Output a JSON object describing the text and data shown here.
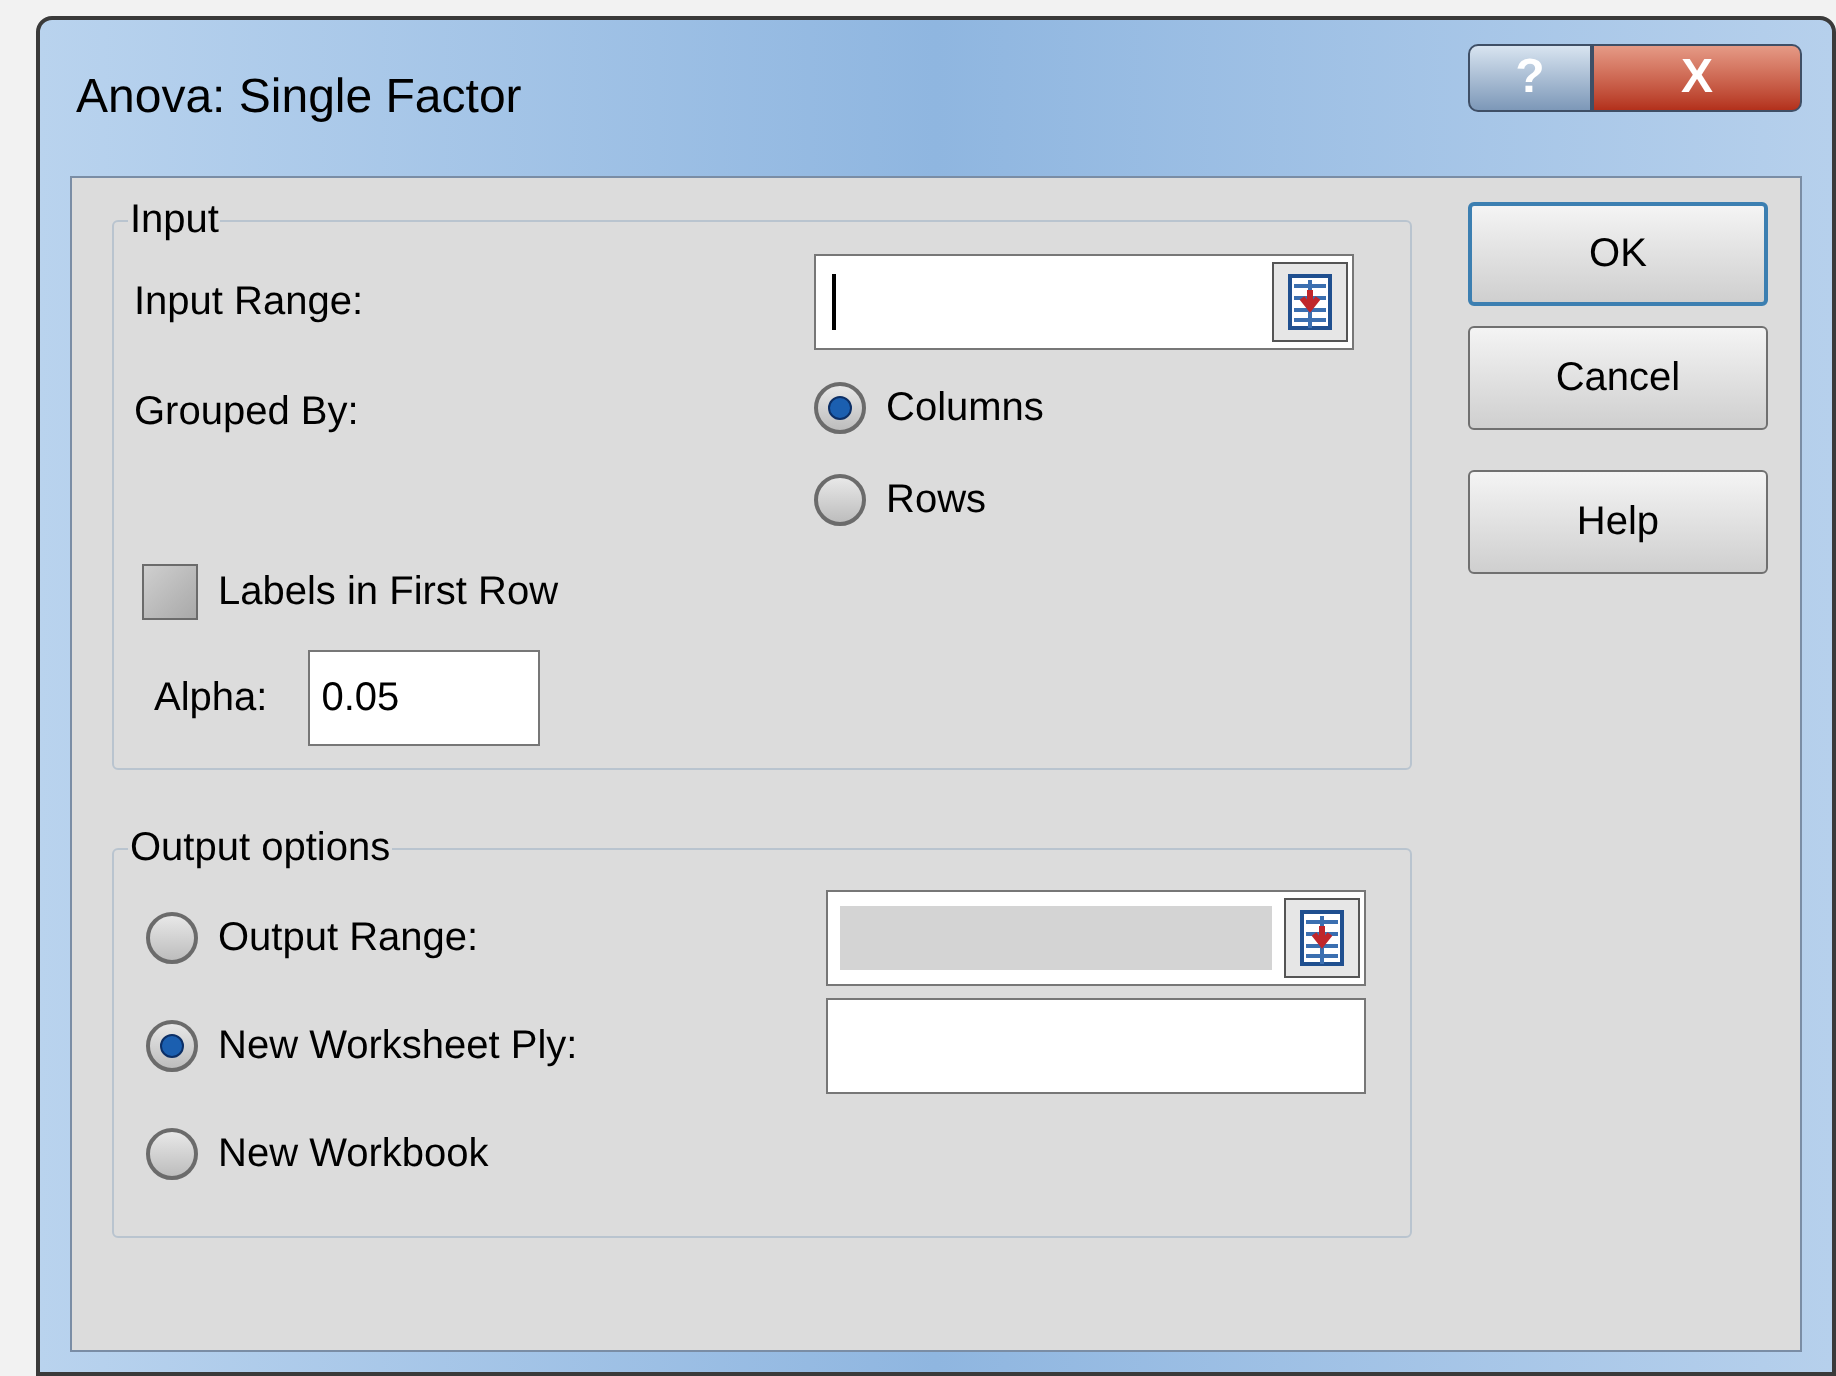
{
  "window": {
    "title": "Anova: Single Factor",
    "title_buttons": [
      {
        "kind": "help",
        "label": "?"
      },
      {
        "kind": "close",
        "label": "X"
      }
    ]
  },
  "input_group": {
    "title": "Input",
    "input_range": {
      "label": "Input Range:",
      "focused": true
    },
    "grouped_by": {
      "label": "Grouped By:",
      "options": [
        {
          "label": "Columns",
          "selected": true
        },
        {
          "label": "Rows",
          "selected": false
        }
      ]
    },
    "labels_checkbox": {
      "label": "Labels in First Row",
      "checked": false
    },
    "alpha": {
      "label": "Alpha:",
      "value": "0.05"
    }
  },
  "output_group": {
    "title": "Output options",
    "options": [
      {
        "label": "Output Range:",
        "selected": false,
        "field": {
          "disabled": true,
          "picker": true
        }
      },
      {
        "label": "New Worksheet Ply:",
        "selected": true,
        "field": {
          "disabled": false,
          "picker": false
        }
      },
      {
        "label": "New Workbook",
        "selected": false
      }
    ]
  },
  "buttons": [
    {
      "label": "OK",
      "default": true
    },
    {
      "label": "Cancel",
      "default": false
    },
    {
      "label": "Help",
      "default": false
    }
  ]
}
